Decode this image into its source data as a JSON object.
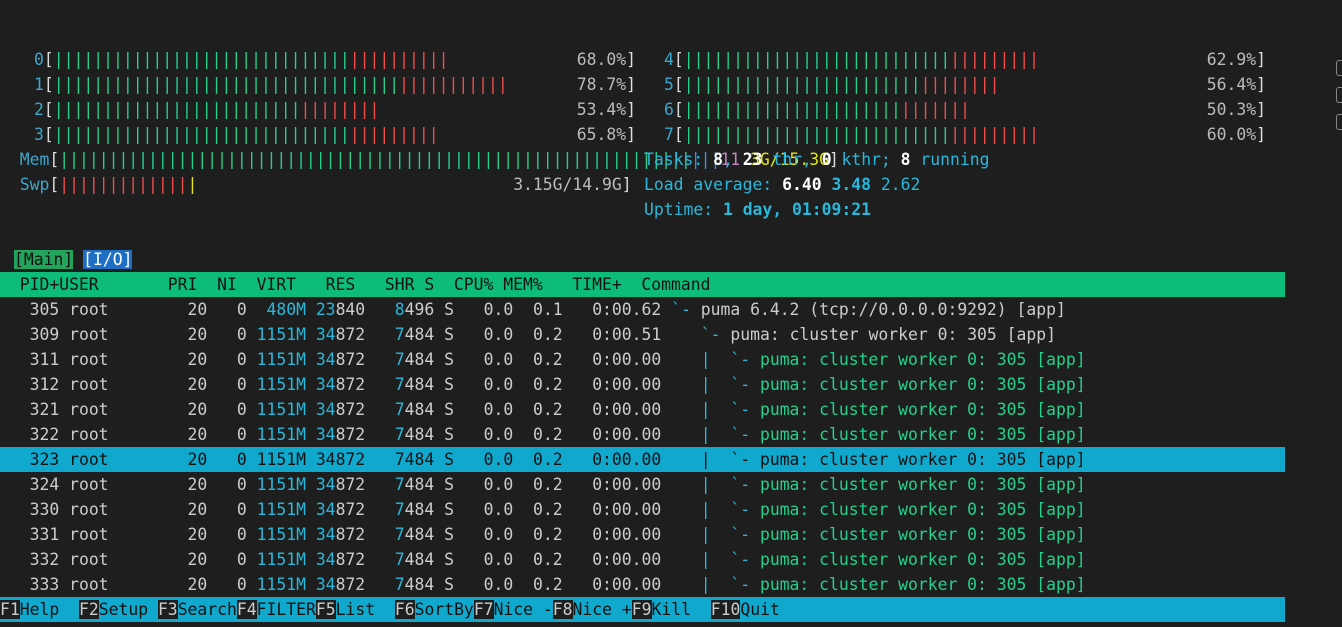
{
  "cpus": [
    {
      "label": "0",
      "bar": "||||||||||||||||||||||||||||||||||||||||",
      "pct": "68.0%"
    },
    {
      "label": "1",
      "bar": "||||||||||||||||||||||||||||||||||||||||||||||",
      "pct": "78.7%"
    },
    {
      "label": "2",
      "bar": "|||||||||||||||||||||||||||||||||",
      "pct": "53.4%"
    },
    {
      "label": "3",
      "bar": "|||||||||||||||||||||||||||||||||||||||",
      "pct": "65.8%"
    },
    {
      "label": "4",
      "bar": "||||||||||||||||||||||||||||||||||||",
      "pct": "62.9%"
    },
    {
      "label": "5",
      "bar": "||||||||||||||||||||||||||||||||",
      "pct": "56.4%"
    },
    {
      "label": "6",
      "bar": "|||||||||||||||||||||||||||||",
      "pct": "50.3%"
    },
    {
      "label": "7",
      "bar": "||||||||||||||||||||||||||||||||||||",
      "pct": "60.0%"
    }
  ],
  "mem": {
    "label": "Mem",
    "value": "11.3G/15.3G",
    "value_a": "11",
    "value_b": ".3G/15.3G"
  },
  "swp": {
    "label": "Swp",
    "value": "3.15G/14.9G"
  },
  "tasks": {
    "label": "Tasks:",
    "count": "8",
    "thr": "23",
    "thr_label": "thr,",
    "kthr": "0",
    "kthr_label": "kthr;",
    "running": "8",
    "running_label": "running"
  },
  "load": {
    "label": "Load average:",
    "l1": "6.40",
    "l5": "3.48",
    "l15": "2.62"
  },
  "uptime": {
    "label": "Uptime:",
    "value": "1 day, 01:09:21"
  },
  "tabs": {
    "main": "[Main]",
    "io": "[I/O]"
  },
  "columns": {
    "header": "  PID+USER       PRI  NI  VIRT   RES   SHR S  CPU% MEM%   TIME+  Command"
  },
  "processes": [
    {
      "pid": "305",
      "user": "root",
      "pri": "20",
      "ni": "0",
      "virt": "480M",
      "res_a": "23",
      "res_b": "840",
      "shr_a": "8",
      "shr_b": "496",
      "s": "S",
      "cpu": "0.0",
      "mem": "0.1",
      "time": "0:00.62",
      "tree": "`- ",
      "cmd": "puma 6.4.2 (tcp://0.0.0.0:9292) [app]",
      "cmd_color": "w"
    },
    {
      "pid": "309",
      "user": "root",
      "pri": "20",
      "ni": "0",
      "virt": "1151M",
      "res_a": "34",
      "res_b": "872",
      "shr_a": "7",
      "shr_b": "484",
      "s": "S",
      "cpu": "0.0",
      "mem": "0.2",
      "time": "0:00.51",
      "tree": "   `- ",
      "cmd": "puma: cluster worker 0: 305 [app]",
      "cmd_color": "w"
    },
    {
      "pid": "311",
      "user": "root",
      "pri": "20",
      "ni": "0",
      "virt": "1151M",
      "res_a": "34",
      "res_b": "872",
      "shr_a": "7",
      "shr_b": "484",
      "s": "S",
      "cpu": "0.0",
      "mem": "0.2",
      "time": "0:00.00",
      "tree": "   |  `- ",
      "cmd": "puma: cluster worker 0: 305 [app]",
      "cmd_color": "g"
    },
    {
      "pid": "312",
      "user": "root",
      "pri": "20",
      "ni": "0",
      "virt": "1151M",
      "res_a": "34",
      "res_b": "872",
      "shr_a": "7",
      "shr_b": "484",
      "s": "S",
      "cpu": "0.0",
      "mem": "0.2",
      "time": "0:00.00",
      "tree": "   |  `- ",
      "cmd": "puma: cluster worker 0: 305 [app]",
      "cmd_color": "g"
    },
    {
      "pid": "321",
      "user": "root",
      "pri": "20",
      "ni": "0",
      "virt": "1151M",
      "res_a": "34",
      "res_b": "872",
      "shr_a": "7",
      "shr_b": "484",
      "s": "S",
      "cpu": "0.0",
      "mem": "0.2",
      "time": "0:00.00",
      "tree": "   |  `- ",
      "cmd": "puma: cluster worker 0: 305 [app]",
      "cmd_color": "g"
    },
    {
      "pid": "322",
      "user": "root",
      "pri": "20",
      "ni": "0",
      "virt": "1151M",
      "res_a": "34",
      "res_b": "872",
      "shr_a": "7",
      "shr_b": "484",
      "s": "S",
      "cpu": "0.0",
      "mem": "0.2",
      "time": "0:00.00",
      "tree": "   |  `- ",
      "cmd": "puma: cluster worker 0: 305 [app]",
      "cmd_color": "g"
    },
    {
      "pid": "323",
      "user": "root",
      "pri": "20",
      "ni": "0",
      "virt": "1151M",
      "res_a": "34",
      "res_b": "872",
      "shr_a": "7",
      "shr_b": "484",
      "s": "S",
      "cpu": "0.0",
      "mem": "0.2",
      "time": "0:00.00",
      "tree": "   |  `- ",
      "cmd": "puma: cluster worker 0: 305 [app]",
      "cmd_color": "g",
      "selected": true
    },
    {
      "pid": "324",
      "user": "root",
      "pri": "20",
      "ni": "0",
      "virt": "1151M",
      "res_a": "34",
      "res_b": "872",
      "shr_a": "7",
      "shr_b": "484",
      "s": "S",
      "cpu": "0.0",
      "mem": "0.2",
      "time": "0:00.00",
      "tree": "   |  `- ",
      "cmd": "puma: cluster worker 0: 305 [app]",
      "cmd_color": "g"
    },
    {
      "pid": "330",
      "user": "root",
      "pri": "20",
      "ni": "0",
      "virt": "1151M",
      "res_a": "34",
      "res_b": "872",
      "shr_a": "7",
      "shr_b": "484",
      "s": "S",
      "cpu": "0.0",
      "mem": "0.2",
      "time": "0:00.00",
      "tree": "   |  `- ",
      "cmd": "puma: cluster worker 0: 305 [app]",
      "cmd_color": "g"
    },
    {
      "pid": "331",
      "user": "root",
      "pri": "20",
      "ni": "0",
      "virt": "1151M",
      "res_a": "34",
      "res_b": "872",
      "shr_a": "7",
      "shr_b": "484",
      "s": "S",
      "cpu": "0.0",
      "mem": "0.2",
      "time": "0:00.00",
      "tree": "   |  `- ",
      "cmd": "puma: cluster worker 0: 305 [app]",
      "cmd_color": "g"
    },
    {
      "pid": "332",
      "user": "root",
      "pri": "20",
      "ni": "0",
      "virt": "1151M",
      "res_a": "34",
      "res_b": "872",
      "shr_a": "7",
      "shr_b": "484",
      "s": "S",
      "cpu": "0.0",
      "mem": "0.2",
      "time": "0:00.00",
      "tree": "   |  `- ",
      "cmd": "puma: cluster worker 0: 305 [app]",
      "cmd_color": "g"
    },
    {
      "pid": "333",
      "user": "root",
      "pri": "20",
      "ni": "0",
      "virt": "1151M",
      "res_a": "34",
      "res_b": "872",
      "shr_a": "7",
      "shr_b": "484",
      "s": "S",
      "cpu": "0.0",
      "mem": "0.2",
      "time": "0:00.00",
      "tree": "   |  `- ",
      "cmd": "puma: cluster worker 0: 305 [app]",
      "cmd_color": "g"
    }
  ],
  "fkeys": [
    {
      "key": "F1",
      "label": "Help  "
    },
    {
      "key": "F2",
      "label": "Setup "
    },
    {
      "key": "F3",
      "label": "Search"
    },
    {
      "key": "F4",
      "label": "FILTER"
    },
    {
      "key": "F5",
      "label": "List  "
    },
    {
      "key": "F6",
      "label": "SortBy"
    },
    {
      "key": "F7",
      "label": "Nice -"
    },
    {
      "key": "F8",
      "label": "Nice +"
    },
    {
      "key": "F9",
      "label": "Kill  "
    },
    {
      "key": "F10",
      "label": "Quit"
    }
  ],
  "colors": {
    "green": "#23d18b",
    "red": "#f14c4c",
    "cyan": "#29b8db",
    "header_bg": "#0dbc79",
    "select_bg": "#11a8cd"
  }
}
